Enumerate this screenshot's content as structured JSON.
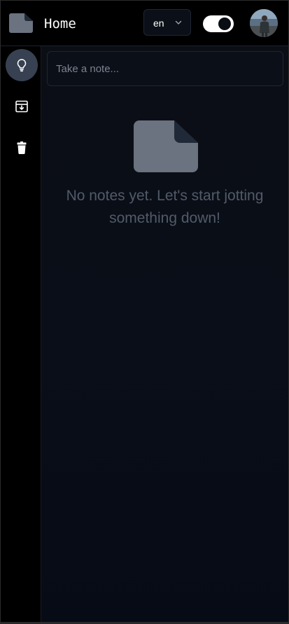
{
  "header": {
    "title": "Home",
    "logo_icon": "note-icon",
    "language": {
      "selected": "en",
      "icon": "chevron-down-icon"
    },
    "theme_toggle": {
      "state": "on",
      "track_color": "#ffffff",
      "knob_color": "#0a0d14"
    },
    "avatar_icon": "user-avatar"
  },
  "sidebar": {
    "items": [
      {
        "name": "notes",
        "icon": "lightbulb-icon",
        "active": true
      },
      {
        "name": "archive",
        "icon": "archive-icon",
        "active": false
      },
      {
        "name": "trash",
        "icon": "trash-icon",
        "active": false
      }
    ],
    "active_color": "#374151"
  },
  "main": {
    "note_input": {
      "placeholder": "Take a note...",
      "value": ""
    },
    "empty_state": {
      "icon": "note-icon",
      "message": "No notes yet. Let's start jotting something down!"
    }
  },
  "colors": {
    "background": "#000000",
    "panel": "#0b0e15",
    "icon_gray": "#6b7280",
    "muted_text": "#525a69"
  }
}
